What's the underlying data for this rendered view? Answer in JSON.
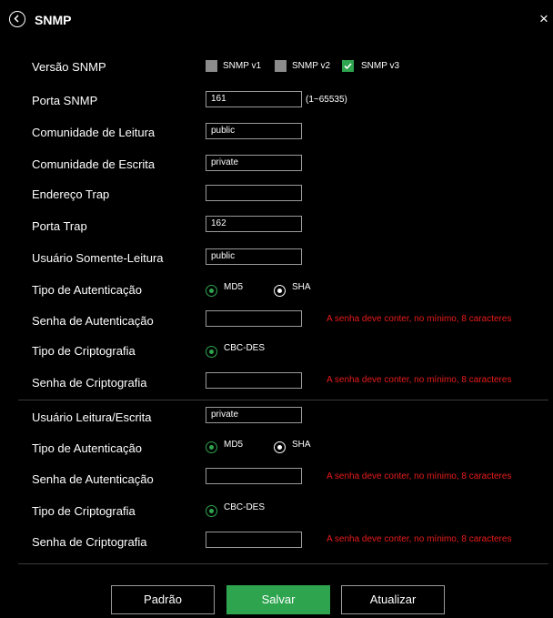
{
  "header": {
    "title": "SNMP",
    "close_glyph": "×"
  },
  "version": {
    "label": "Versão SNMP",
    "options": [
      {
        "label": "SNMP v1",
        "checked": false
      },
      {
        "label": "SNMP v2",
        "checked": false
      },
      {
        "label": "SNMP v3",
        "checked": true
      }
    ]
  },
  "port": {
    "label": "Porta SNMP",
    "value": "161",
    "hint": "(1~65535)"
  },
  "read_community": {
    "label": "Comunidade de Leitura",
    "value": "public"
  },
  "write_community": {
    "label": "Comunidade de Escrita",
    "value": "private"
  },
  "trap_address": {
    "label": "Endereço Trap",
    "value": ""
  },
  "trap_port": {
    "label": "Porta Trap",
    "value": "162"
  },
  "ro_user": {
    "label": "Usuário Somente-Leitura",
    "value": "public",
    "auth_type_label": "Tipo de Autenticação",
    "auth_options": [
      "MD5",
      "SHA"
    ],
    "auth_password_label": "Senha de Autenticação",
    "auth_password_error": "A senha deve conter, no mínimo, 8 caracteres",
    "crypto_type_label": "Tipo de Criptografia",
    "crypto_option": "CBC-DES",
    "crypto_password_label": "Senha de Criptografia",
    "crypto_password_error": "A senha deve conter, no mínimo, 8 caracteres"
  },
  "rw_user": {
    "label": "Usuário Leitura/Escrita",
    "value": "private",
    "auth_type_label": "Tipo de Autenticação",
    "auth_options": [
      "MD5",
      "SHA"
    ],
    "auth_password_label": "Senha de Autenticação",
    "auth_password_error": "A senha deve conter, no mínimo, 8 caracteres",
    "crypto_type_label": "Tipo de Criptografia",
    "crypto_option": "CBC-DES",
    "crypto_password_label": "Senha de Criptografia",
    "crypto_password_error": "A senha deve conter, no mínimo, 8 caracteres"
  },
  "buttons": {
    "default": "Padrão",
    "save": "Salvar",
    "refresh": "Atualizar"
  },
  "colors": {
    "accent": "#2ea44f",
    "error": "#e81b1b",
    "background": "#000000"
  }
}
